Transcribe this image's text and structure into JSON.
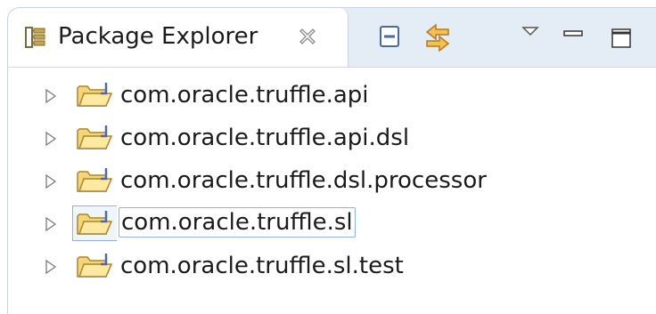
{
  "view": {
    "tab": {
      "label": "Package Explorer",
      "icon": "package-explorer-icon",
      "close_icon": "close-icon"
    },
    "toolbar": [
      {
        "name": "collapse-all-button",
        "icon": "collapse-all-icon"
      },
      {
        "name": "link-with-editor-button",
        "icon": "link-arrows-icon"
      },
      {
        "name": "view-menu-button",
        "icon": "triangle-down-icon"
      },
      {
        "name": "minimize-button",
        "icon": "minimize-icon"
      },
      {
        "name": "maximize-button",
        "icon": "maximize-icon"
      }
    ]
  },
  "tree": {
    "items": [
      {
        "label": "com.oracle.truffle.api",
        "selected": false
      },
      {
        "label": "com.oracle.truffle.api.dsl",
        "selected": false
      },
      {
        "label": "com.oracle.truffle.dsl.processor",
        "selected": false
      },
      {
        "label": "com.oracle.truffle.sl",
        "selected": true
      },
      {
        "label": "com.oracle.truffle.sl.test",
        "selected": false
      }
    ]
  },
  "colors": {
    "tabbar_bg": "#e4ecf5",
    "selection_border": "#8fb3d9",
    "folder_yellow": "#e7c35a",
    "arrow_orange": "#e5a22e"
  }
}
